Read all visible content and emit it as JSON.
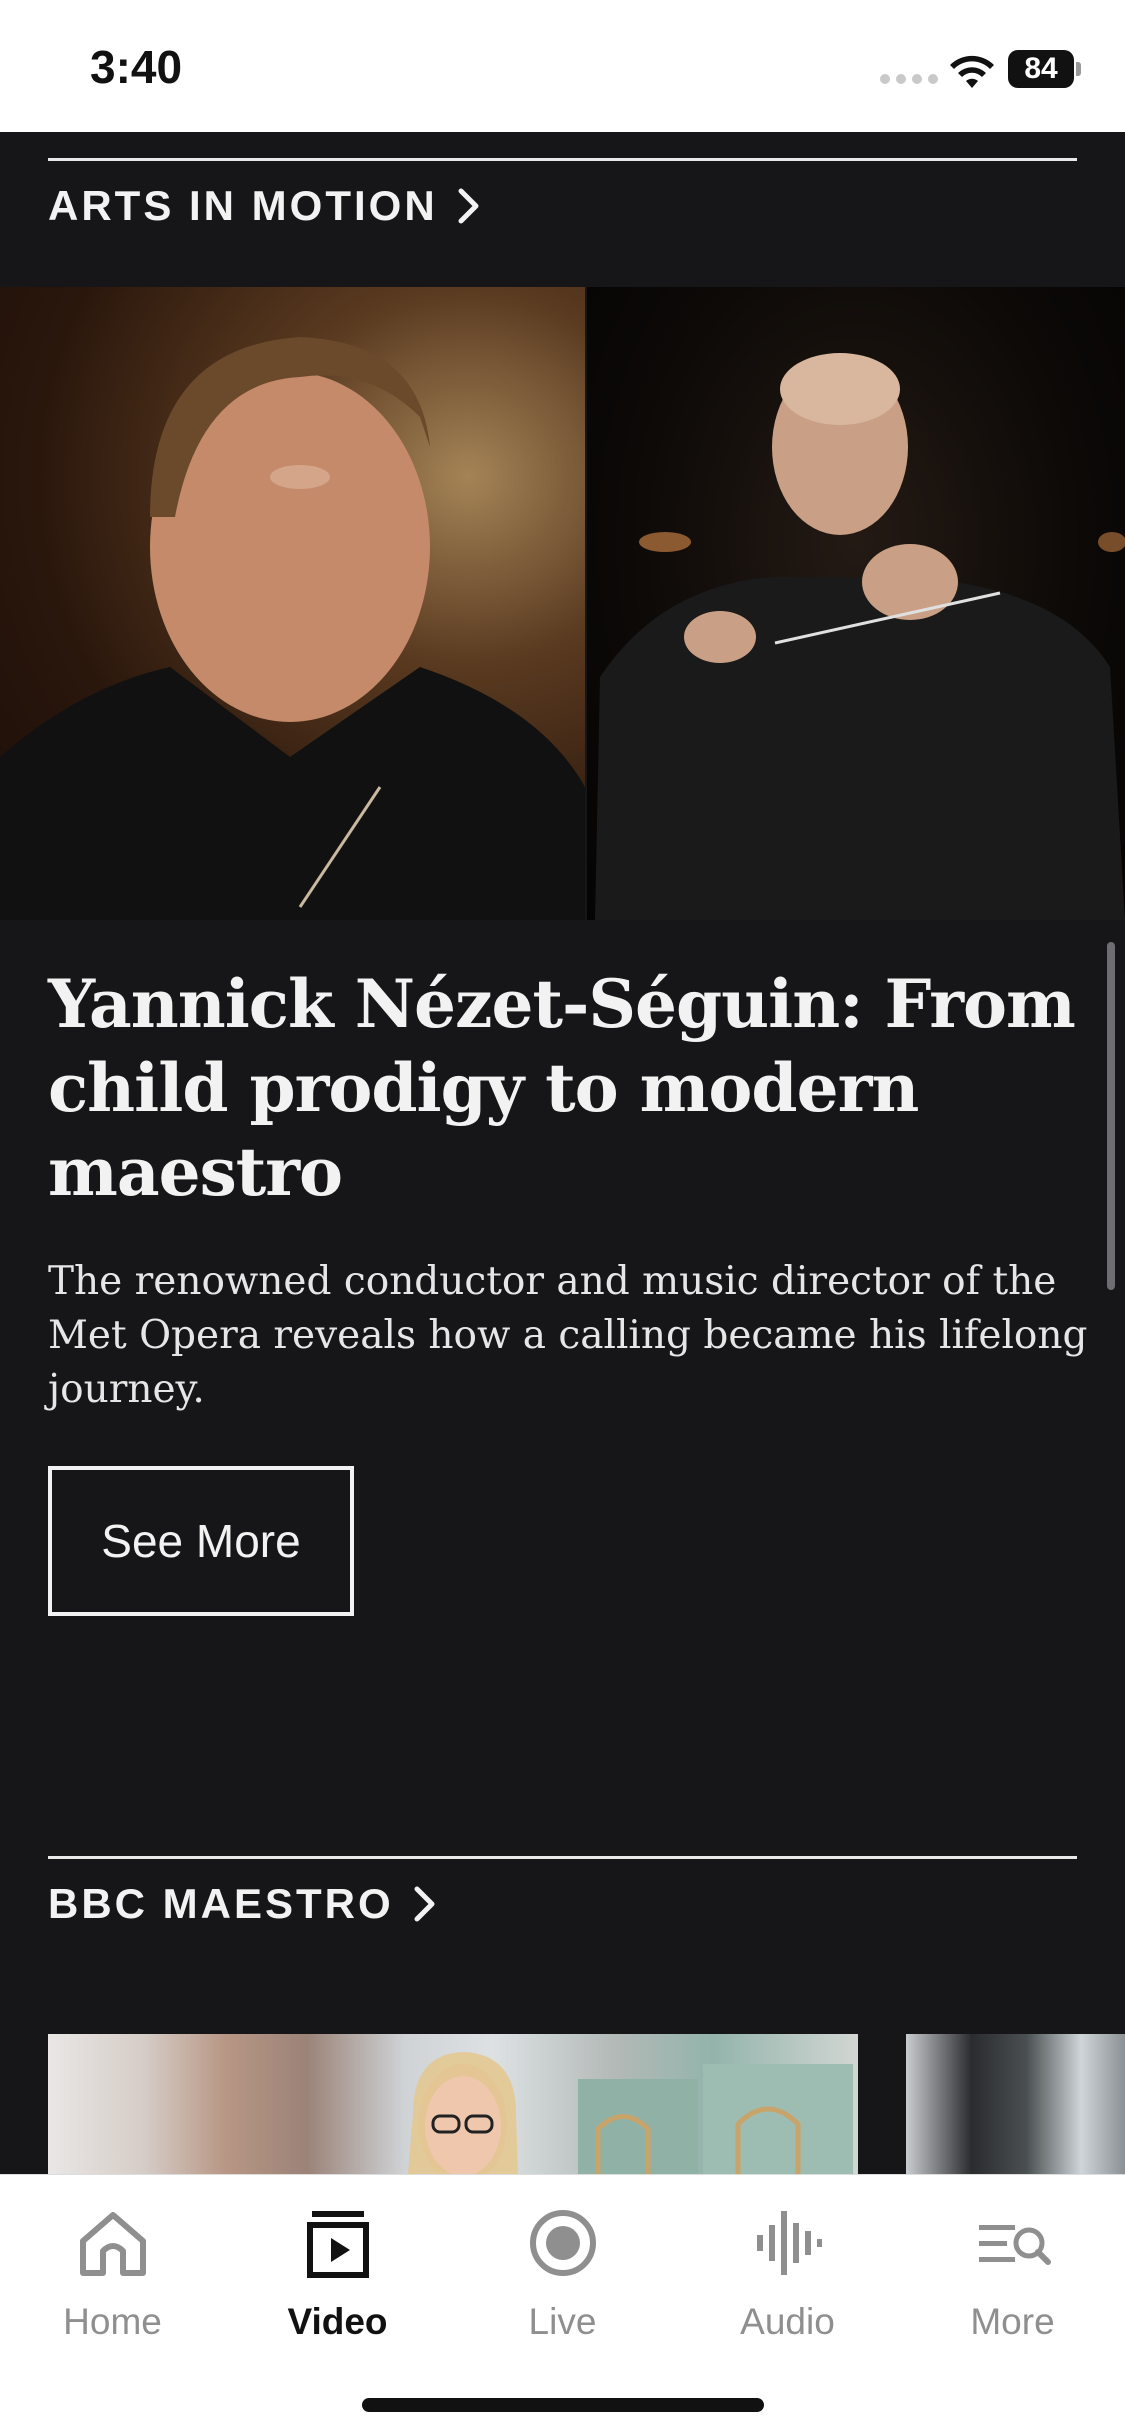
{
  "status_bar": {
    "time": "3:40",
    "battery": "84"
  },
  "sections": [
    {
      "title": "ARTS IN MOTION"
    },
    {
      "title": "BBC MAESTRO"
    }
  ],
  "article": {
    "title": "Yannick Nézet-Séguin: From child prodigy to modern maestro",
    "description": "The renowned conductor and music director of the Met Opera reveals how a calling became his lifelong journey.",
    "button_label": "See More"
  },
  "nav": {
    "items": [
      {
        "label": "Home",
        "icon": "home-icon",
        "active": false
      },
      {
        "label": "Video",
        "icon": "video-icon",
        "active": true
      },
      {
        "label": "Live",
        "icon": "live-icon",
        "active": false
      },
      {
        "label": "Audio",
        "icon": "audio-icon",
        "active": false
      },
      {
        "label": "More",
        "icon": "more-search-icon",
        "active": false
      }
    ]
  },
  "colors": {
    "background": "#161618",
    "text": "#f2f2f2",
    "nav_active": "#111111",
    "nav_inactive": "#8f8f8f"
  }
}
